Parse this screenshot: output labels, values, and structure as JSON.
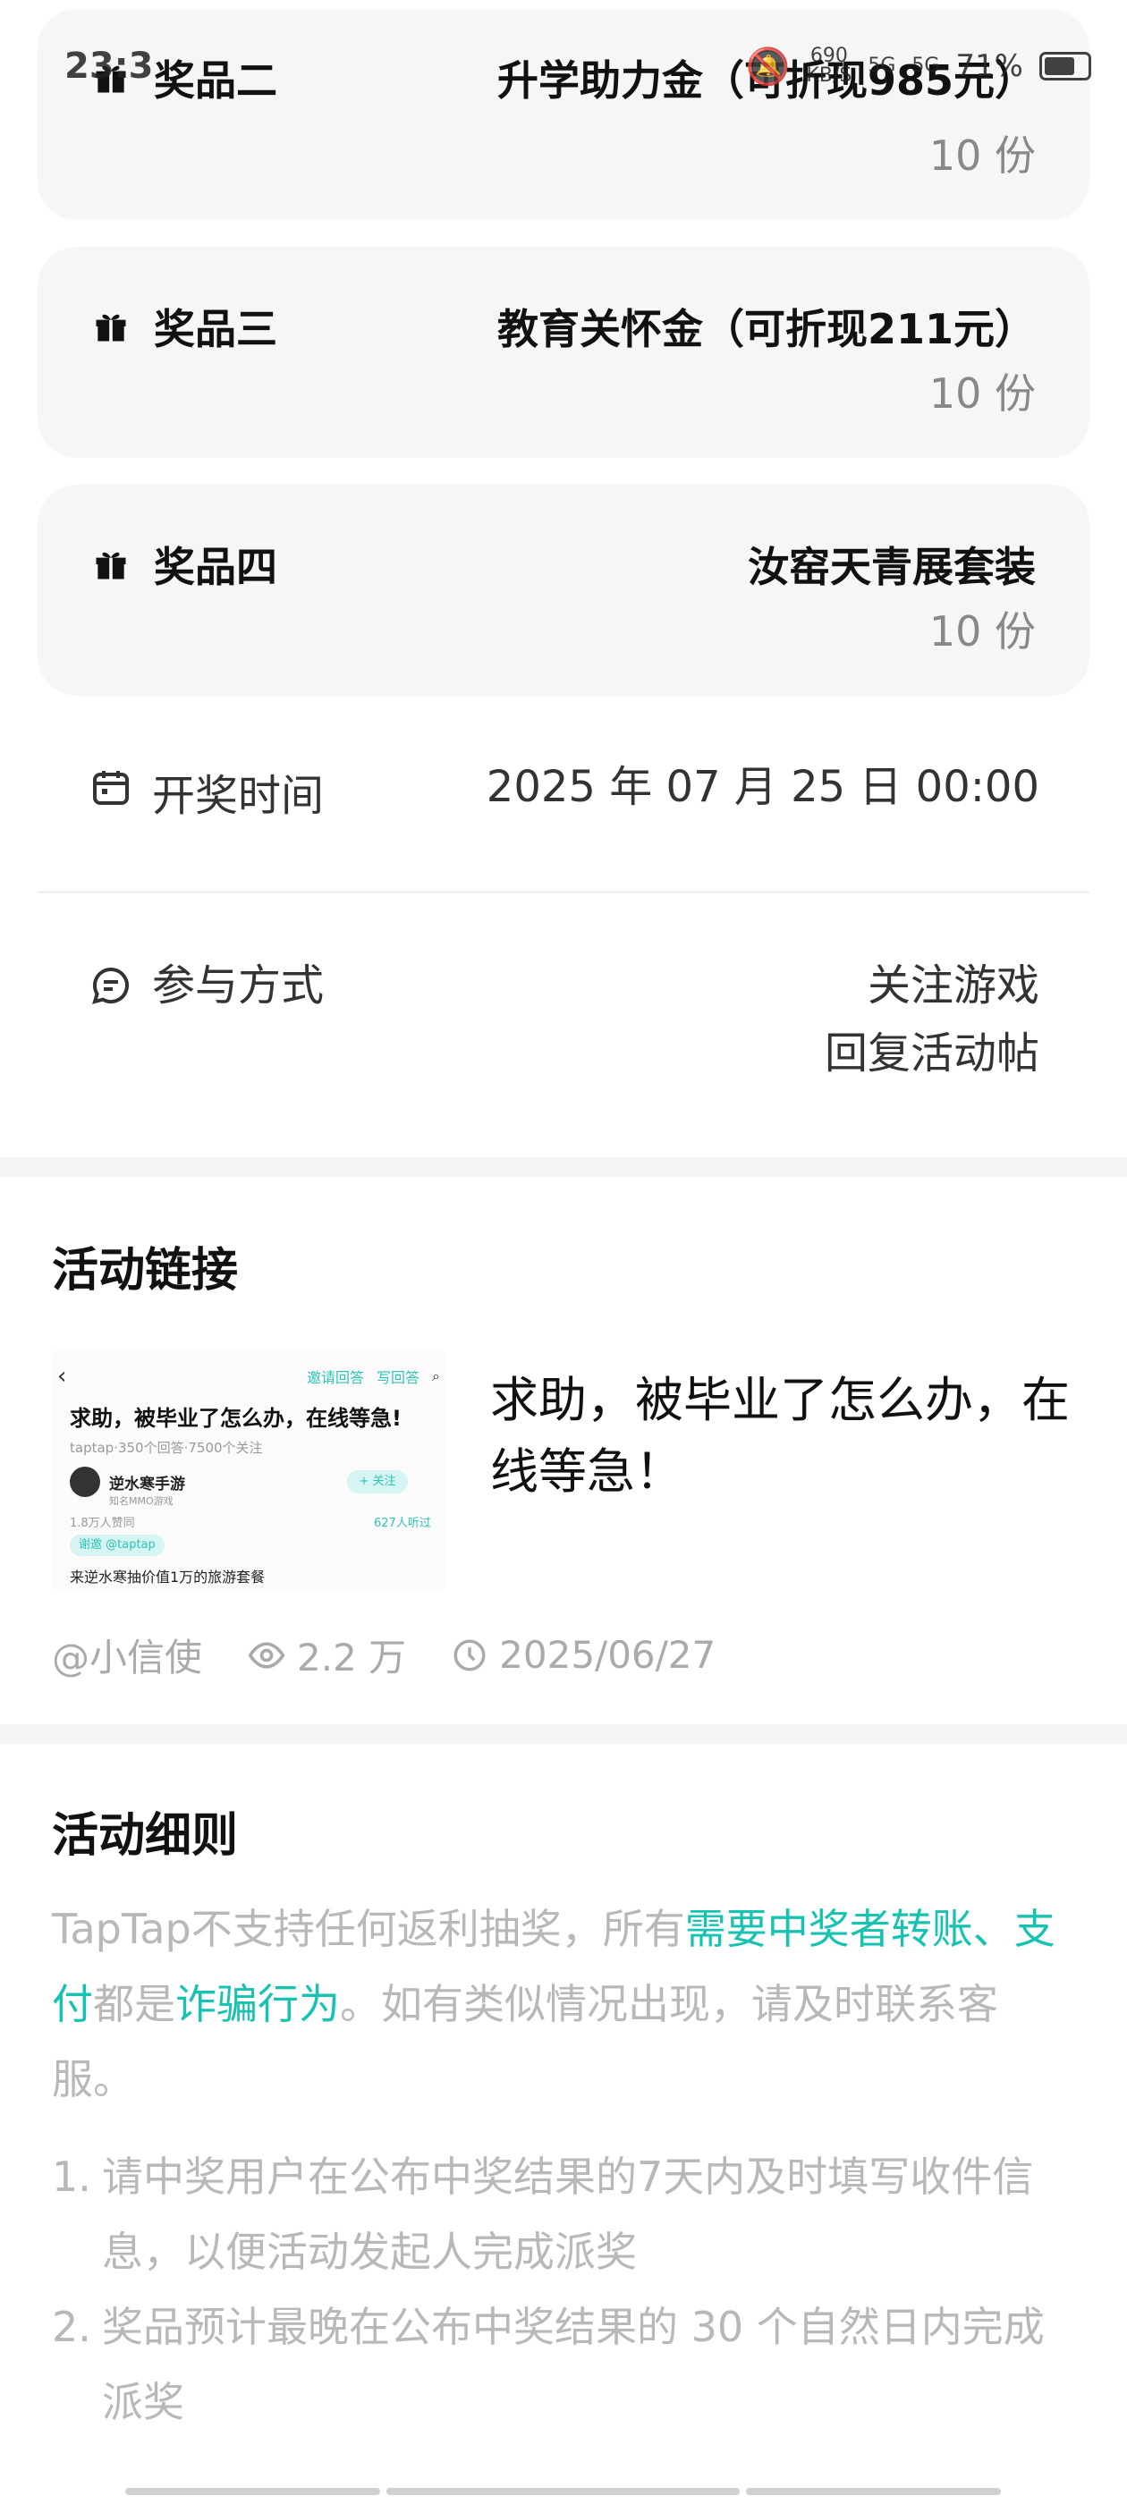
{
  "status_bar": {
    "time": "23:3",
    "network_top": "690",
    "network_bottom": "KB/S",
    "signal1": "5G",
    "signal2": "5G",
    "battery_text": "71%",
    "battery_level": 0.71
  },
  "prizes": [
    {
      "name": "奖品二",
      "title": "升学助力金（可折现985元）",
      "count": "10 份"
    },
    {
      "name": "奖品三",
      "title": "教育关怀金（可折现211元）",
      "count": "10 份"
    },
    {
      "name": "奖品四",
      "title": "汝窑天青展套装",
      "count": "10 份"
    }
  ],
  "draw_time": {
    "label": "开奖时间",
    "value": "2025 年 07 月 25 日 00:00"
  },
  "participation": {
    "label": "参与方式",
    "values": [
      "关注游戏",
      "回复活动帖"
    ]
  },
  "activity_link": {
    "section_title": "活动链接",
    "thumbnail": {
      "invite_answer": "邀请回答",
      "write_answer": "写回答",
      "title": "求助，被毕业了怎么办，在线等急!",
      "subtitle": "taptap·350个回答·7500个关注",
      "author": "逆水寒手游",
      "author_tag": "知名MMO游戏",
      "follow": "+ 关注",
      "likes": "1.8万人赞同",
      "listens": "627人听过",
      "tag": "谢邀 @taptap",
      "footer": "来逆水寒抽价值1万的旅游套餐"
    },
    "title": "求助，被毕业了怎么办，在线等急！",
    "author": "@小信使",
    "views": "2.2 万",
    "date": "2025/06/27"
  },
  "rules": {
    "section_title": "活动细则",
    "intro_parts": [
      {
        "text": "TapTap不支持任何返利抽奖，所有",
        "highlight": false
      },
      {
        "text": "需要中奖者转账、支付",
        "highlight": true
      },
      {
        "text": "都是",
        "highlight": false
      },
      {
        "text": "诈骗行为",
        "highlight": true
      },
      {
        "text": "。如有类似情况出现，请及时联系客服。",
        "highlight": false
      }
    ],
    "items": [
      {
        "num": "1.",
        "text": "请中奖用户在公布中奖结果的7天内及时填写收件信息，以便活动发起人完成派奖"
      },
      {
        "num": "2.",
        "text": "奖品预计最晚在公布中奖结果的 30 个自然日内完成派奖"
      }
    ]
  },
  "colors": {
    "accent": "#18c2b0",
    "muted": "#b8b8b8",
    "card_bg": "#f5f6f7"
  }
}
